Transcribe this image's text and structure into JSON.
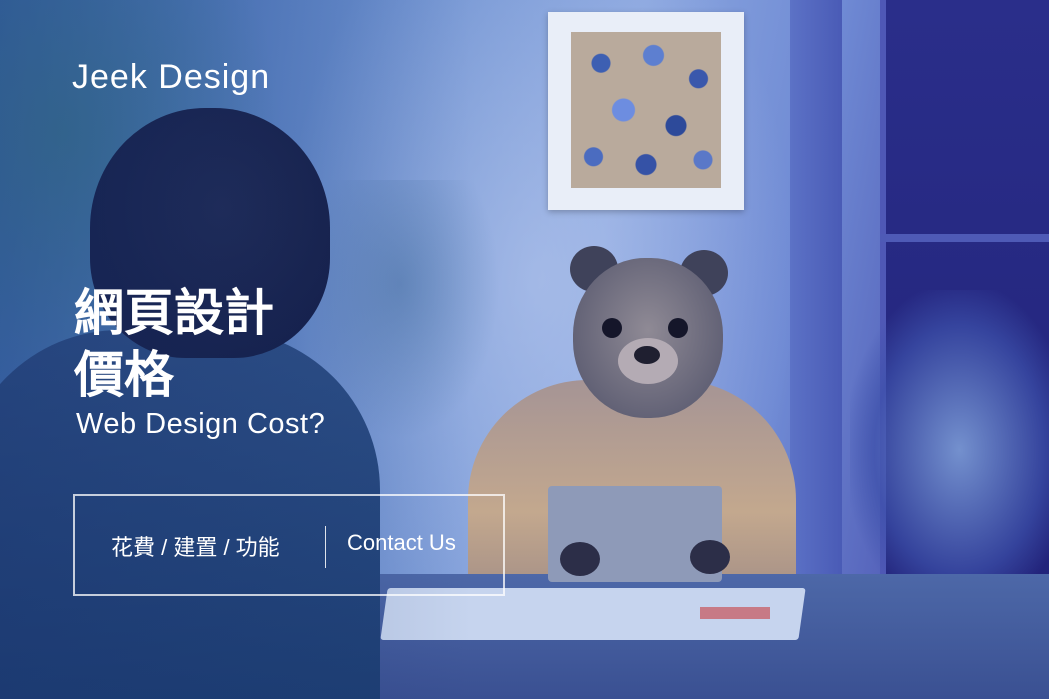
{
  "brand": {
    "name": "Jeek Design"
  },
  "hero": {
    "title_line1": "網頁設計",
    "title_line2": "價格",
    "subtitle": "Web Design Cost?"
  },
  "cta": {
    "primary_label": "花費 / 建置 / 功能",
    "secondary_label": "Contact Us"
  },
  "colors": {
    "text": "#ffffff",
    "overlay_blue": "#3b5fb4",
    "border": "#ffffffbf"
  }
}
